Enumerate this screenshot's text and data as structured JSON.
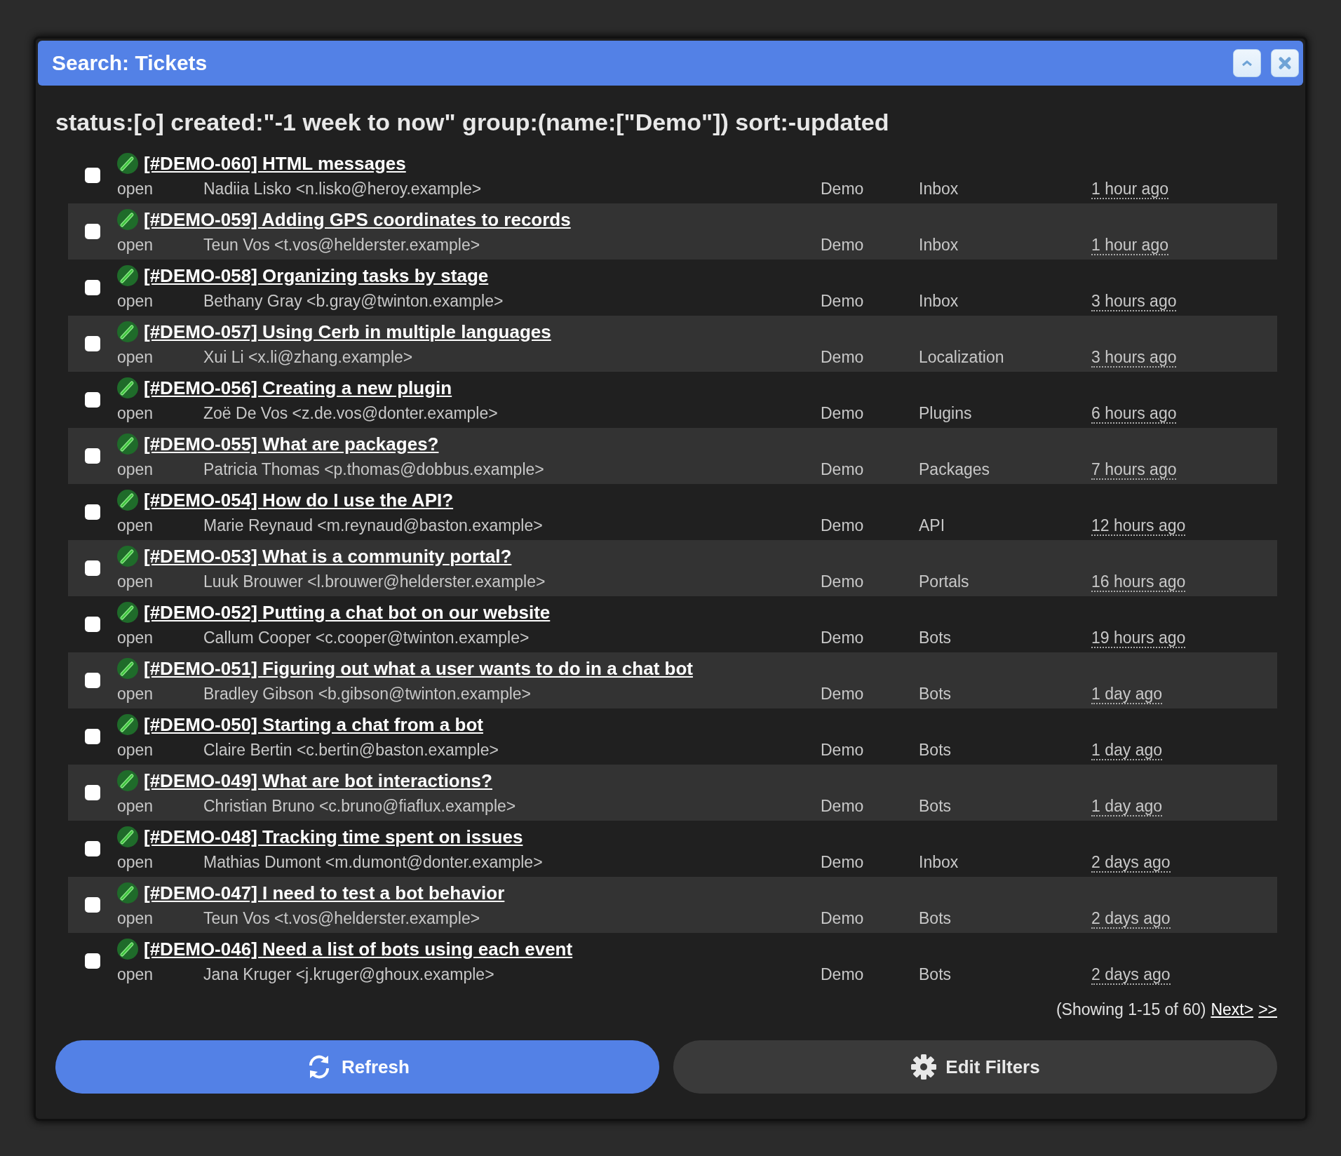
{
  "window": {
    "title": "Search: Tickets"
  },
  "query": "status:[o] created:\"-1 week to now\" group:(name:[\"Demo\"]) sort:-updated",
  "rows": [
    {
      "title": "[#DEMO-060] HTML messages",
      "status": "open",
      "requester": "Nadiia Lisko <n.lisko@heroy.example>",
      "group": "Demo",
      "bucket": "Inbox",
      "updated": "1 hour ago",
      "checked": false
    },
    {
      "title": "[#DEMO-059] Adding GPS coordinates to records",
      "status": "open",
      "requester": "Teun Vos <t.vos@helderster.example>",
      "group": "Demo",
      "bucket": "Inbox",
      "updated": "1 hour ago",
      "checked": false
    },
    {
      "title": "[#DEMO-058] Organizing tasks by stage",
      "status": "open",
      "requester": "Bethany Gray <b.gray@twinton.example>",
      "group": "Demo",
      "bucket": "Inbox",
      "updated": "3 hours ago",
      "checked": false
    },
    {
      "title": "[#DEMO-057] Using Cerb in multiple languages",
      "status": "open",
      "requester": "Xui Li <x.li@zhang.example>",
      "group": "Demo",
      "bucket": "Localization",
      "updated": "3 hours ago",
      "checked": false
    },
    {
      "title": "[#DEMO-056] Creating a new plugin",
      "status": "open",
      "requester": "Zoë De Vos <z.de.vos@donter.example>",
      "group": "Demo",
      "bucket": "Plugins",
      "updated": "6 hours ago",
      "checked": false
    },
    {
      "title": "[#DEMO-055] What are packages?",
      "status": "open",
      "requester": "Patricia Thomas <p.thomas@dobbus.example>",
      "group": "Demo",
      "bucket": "Packages",
      "updated": "7 hours ago",
      "checked": false
    },
    {
      "title": "[#DEMO-054] How do I use the API?",
      "status": "open",
      "requester": "Marie Reynaud <m.reynaud@baston.example>",
      "group": "Demo",
      "bucket": "API",
      "updated": "12 hours ago",
      "checked": false
    },
    {
      "title": "[#DEMO-053] What is a community portal?",
      "status": "open",
      "requester": "Luuk Brouwer <l.brouwer@helderster.example>",
      "group": "Demo",
      "bucket": "Portals",
      "updated": "16 hours ago",
      "checked": false
    },
    {
      "title": "[#DEMO-052] Putting a chat bot on our website",
      "status": "open",
      "requester": "Callum Cooper <c.cooper@twinton.example>",
      "group": "Demo",
      "bucket": "Bots",
      "updated": "19 hours ago",
      "checked": false
    },
    {
      "title": "[#DEMO-051] Figuring out what a user wants to do in a chat bot",
      "status": "open",
      "requester": "Bradley Gibson <b.gibson@twinton.example>",
      "group": "Demo",
      "bucket": "Bots",
      "updated": "1 day ago",
      "checked": false
    },
    {
      "title": "[#DEMO-050] Starting a chat from a bot",
      "status": "open",
      "requester": "Claire Bertin <c.bertin@baston.example>",
      "group": "Demo",
      "bucket": "Bots",
      "updated": "1 day ago",
      "checked": false
    },
    {
      "title": "[#DEMO-049] What are bot interactions?",
      "status": "open",
      "requester": "Christian Bruno <c.bruno@fiaflux.example>",
      "group": "Demo",
      "bucket": "Bots",
      "updated": "1 day ago",
      "checked": false
    },
    {
      "title": "[#DEMO-048] Tracking time spent on issues",
      "status": "open",
      "requester": "Mathias Dumont <m.dumont@donter.example>",
      "group": "Demo",
      "bucket": "Inbox",
      "updated": "2 days ago",
      "checked": false
    },
    {
      "title": "[#DEMO-047] I need to test a bot behavior",
      "status": "open",
      "requester": "Teun Vos <t.vos@helderster.example>",
      "group": "Demo",
      "bucket": "Bots",
      "updated": "2 days ago",
      "checked": false
    },
    {
      "title": "[#DEMO-046] Need a list of bots using each event",
      "status": "open",
      "requester": "Jana Kruger <j.kruger@ghoux.example>",
      "group": "Demo",
      "bucket": "Bots",
      "updated": "2 days ago",
      "checked": false
    }
  ],
  "pager": {
    "summary": "(Showing 1-15 of 60)",
    "next": "Next>",
    "last": ">>"
  },
  "buttons": [
    {
      "label": "Refresh",
      "kind": "primary"
    },
    {
      "label": "Edit Filters",
      "kind": "secondary"
    }
  ]
}
